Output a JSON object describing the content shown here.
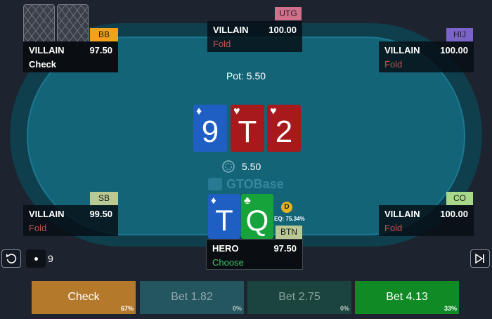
{
  "table": {
    "pot_label": "Pot: 5.50",
    "pot_amount": "5.50",
    "watermark": "GTOBase"
  },
  "board": [
    {
      "rank": "9",
      "suit": "♦",
      "color": "#1f5fc4"
    },
    {
      "rank": "T",
      "suit": "♥",
      "color": "#a8191b"
    },
    {
      "rank": "2",
      "suit": "♥",
      "color": "#a8191b"
    }
  ],
  "seats": {
    "utg": {
      "position": "UTG",
      "name": "VILLAIN",
      "stack": "100.00",
      "action": "Fold"
    },
    "hij": {
      "position": "HIJ",
      "name": "VILLAIN",
      "stack": "100.00",
      "action": "Fold"
    },
    "bb": {
      "position": "BB",
      "name": "VILLAIN",
      "stack": "97.50",
      "action": "Check"
    },
    "sb": {
      "position": "SB",
      "name": "VILLAIN",
      "stack": "99.50",
      "action": "Fold"
    },
    "co": {
      "position": "CO",
      "name": "VILLAIN",
      "stack": "100.00",
      "action": "Fold"
    },
    "btn": {
      "position": "BTN",
      "name": "HERO",
      "stack": "97.50",
      "action": "Choose"
    }
  },
  "hero": {
    "cards": [
      {
        "rank": "T",
        "suit": "♦",
        "color": "#1f5fc4"
      },
      {
        "rank": "Q",
        "suit": "♣",
        "color": "#17a33b"
      }
    ],
    "dealer_label": "D",
    "equity": "EQ: 75.34%"
  },
  "controls": {
    "street_count": "9"
  },
  "actions": [
    {
      "label": "Check",
      "freq": "67%",
      "color": "#b5792c"
    },
    {
      "label": "Bet 1.82",
      "freq": "0%",
      "color": "#245660"
    },
    {
      "label": "Bet 2.75",
      "freq": "0%",
      "color": "#1b443e"
    },
    {
      "label": "Bet 4.13",
      "freq": "33%",
      "color": "#0f8a24"
    }
  ],
  "colors": {
    "background": "#1d2430",
    "felt": "#146478",
    "rail": "#0f3e4d",
    "fold_text": "#b8564f",
    "choose_text": "#42c56a"
  }
}
